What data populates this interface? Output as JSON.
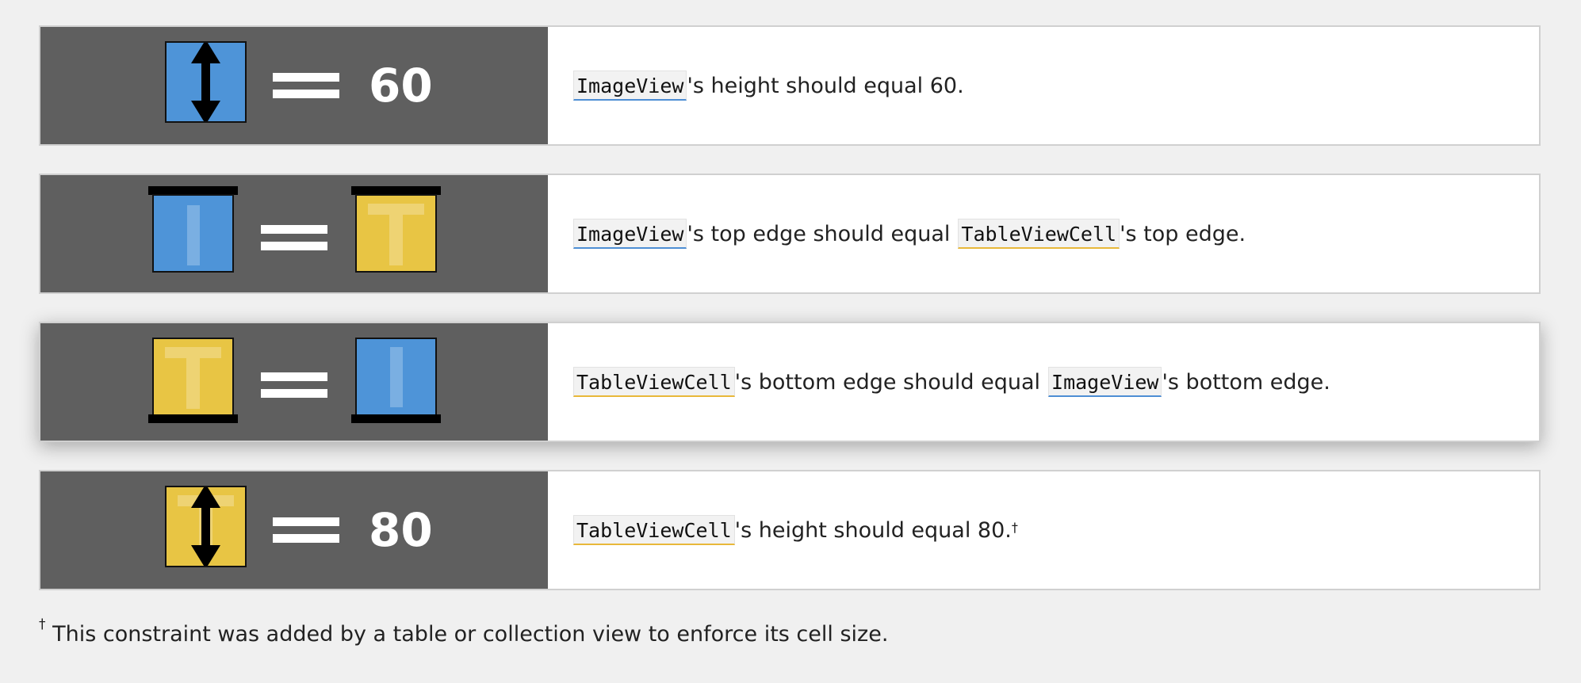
{
  "rows": [
    {
      "icon": "blue-box-height-arrow-icon",
      "value": "60",
      "subject": "ImageView",
      "text_1": "'s height should equal 60."
    },
    {
      "icon_left": "blue-box-top-edge-icon",
      "icon_right": "yellow-box-top-edge-icon",
      "subject": "ImageView",
      "text_1": "'s top edge should equal",
      "object": "TableViewCell",
      "text_2": "'s top edge."
    },
    {
      "icon_left": "yellow-box-bottom-edge-icon",
      "icon_right": "blue-box-bottom-edge-icon",
      "subject": "TableViewCell",
      "text_1": "'s bottom edge should equal",
      "object": "ImageView",
      "text_2": "'s bottom edge."
    },
    {
      "icon": "yellow-box-height-arrow-icon",
      "value": "80",
      "subject": "TableViewCell",
      "text_1": "'s height should equal 80.",
      "footnote_mark": "†"
    }
  ],
  "operator": "==",
  "footnote": {
    "mark": "†",
    "text": "This constraint was added by a table or collection view to enforce its cell size."
  },
  "colors": {
    "background": "#f0f0f0",
    "panel": "#5f5f5f",
    "imageview_blue": "#4e94d8",
    "tableviewcell_yellow": "#e8c544"
  }
}
